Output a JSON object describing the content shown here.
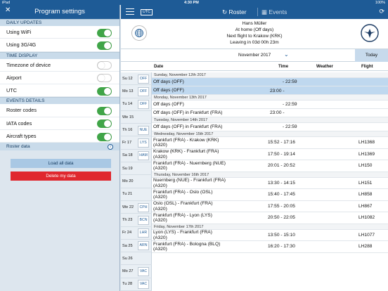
{
  "status": {
    "net": "iPad",
    "time": "4:30 PM",
    "battery": "100%"
  },
  "left": {
    "title": "Program settings",
    "close_icon": "close-icon",
    "sections": [
      {
        "label": "DAILY UPDATES",
        "rows": [
          {
            "label": "Using WiFi",
            "on": true
          },
          {
            "label": "Using 3G/4G",
            "on": true
          }
        ]
      },
      {
        "label": "TIME DISPLAY",
        "rows": [
          {
            "label": "Timezone of device",
            "on": false
          },
          {
            "label": "Airport",
            "on": false
          },
          {
            "label": "UTC",
            "on": true
          }
        ]
      },
      {
        "label": "EVENTS DETAILS",
        "rows": [
          {
            "label": "Roster codes",
            "on": true
          },
          {
            "label": "IATA codes",
            "on": true
          },
          {
            "label": "Aircraft types",
            "on": true
          }
        ]
      }
    ],
    "roster_data_label": "Roster data",
    "load_label": "Load all data",
    "delete_label": "Delete my data"
  },
  "right": {
    "utc_badge": "UTC",
    "tab_roster": "Roster",
    "tab_events": "Events",
    "profile": {
      "name": "Hans Müller",
      "status": "At home (Off days)",
      "next": "Next flight to Krakow (KRK)",
      "leaving": "Leaving in 03d 00h 23m"
    },
    "month": "November 2017",
    "today": "Today",
    "cols": {
      "date": "Date",
      "time": "Time",
      "weather": "Weather",
      "flight": "Flight"
    }
  },
  "colors": {
    "accent": "#1e5b96",
    "toggle_on": "#40a548",
    "delete": "#e0282e"
  },
  "days": [
    {
      "label": "Su  12",
      "code": "OFF"
    },
    {
      "label": "Mo 13",
      "code": "OFF"
    },
    {
      "label": "Tu  14",
      "code": "OFF"
    },
    {
      "label": "We 15",
      "code": ""
    },
    {
      "label": "Th  16",
      "code": "NUE"
    },
    {
      "label": "Fr  17",
      "code": "LYS"
    },
    {
      "label": "Sa  18",
      "code": "HAM"
    },
    {
      "label": "Su  19",
      "code": ""
    },
    {
      "label": "Mo 20",
      "code": ""
    },
    {
      "label": "Tu  21",
      "code": ""
    },
    {
      "label": "We 22",
      "code": "CPH"
    },
    {
      "label": "Th  23",
      "code": "BCN"
    },
    {
      "label": "Fr  24",
      "code": "LHR"
    },
    {
      "label": "Sa  25",
      "code": "ARN"
    },
    {
      "label": "Su  26",
      "code": ""
    },
    {
      "label": "Mo 27",
      "code": "VAC"
    },
    {
      "label": "Tu  28",
      "code": "VAC"
    }
  ],
  "rows": [
    {
      "kind": "sep",
      "text": "Sunday, November 12th 2017"
    },
    {
      "kind": "ev",
      "text": "Off days (OFF)",
      "time": "- 22:59",
      "flight": "",
      "sel": true
    },
    {
      "kind": "ev",
      "text": "Off days (OFF)",
      "time": "23:00 -",
      "flight": "",
      "sel": true
    },
    {
      "kind": "sep",
      "text": "Monday, November 13th 2017"
    },
    {
      "kind": "ev",
      "text": "Off days (OFF)",
      "time": "- 22:59",
      "flight": ""
    },
    {
      "kind": "ev",
      "text": "Off days (OFF) in Frankfurt (FRA)",
      "time": "23:00 -",
      "flight": ""
    },
    {
      "kind": "sep",
      "text": "Tuesday, November 14th 2017"
    },
    {
      "kind": "ev",
      "text": "Off days (OFF) in Frankfurt (FRA)",
      "time": "- 22:59",
      "flight": ""
    },
    {
      "kind": "sep",
      "text": "Wednesday, November 15th 2017"
    },
    {
      "kind": "ev2",
      "text": "Frankfurt (FRA) - Krakow (KRK)",
      "text2": "(A320)",
      "time": "15:52 - 17:16",
      "flight": "LH1368"
    },
    {
      "kind": "ev2",
      "text": "Krakow (KRK) - Frankfurt (FRA)",
      "text2": "(A320)",
      "time": "17:50 - 19:14",
      "flight": "LH1369"
    },
    {
      "kind": "ev2",
      "text": "Frankfurt (FRA) - Nuernberg (NUE)",
      "text2": "(A320)",
      "time": "20:01 - 20:52",
      "flight": "LH150"
    },
    {
      "kind": "sep",
      "text": "Thursday, November 16th 2017"
    },
    {
      "kind": "ev2",
      "text": "Nuernberg (NUE) - Frankfurt (FRA)",
      "text2": "(A320)",
      "time": "13:30 - 14:15",
      "flight": "LH151"
    },
    {
      "kind": "ev2",
      "text": "Frankfurt (FRA) - Oslo (OSL)",
      "text2": "(A320)",
      "time": "15:40 - 17:45",
      "flight": "LH858"
    },
    {
      "kind": "ev2",
      "text": "Oslo (OSL) - Frankfurt (FRA)",
      "text2": "(A320)",
      "time": "17:55 - 20:05",
      "flight": "LH867"
    },
    {
      "kind": "ev2",
      "text": "Frankfurt (FRA) - Lyon (LYS)",
      "text2": "(A320)",
      "time": "20:50 - 22:05",
      "flight": "LH1082"
    },
    {
      "kind": "sep",
      "text": "Friday, November 17th 2017"
    },
    {
      "kind": "ev2",
      "text": "Lyon (LYS) - Frankfurt (FRA)",
      "text2": "(A320)",
      "time": "13:50 - 15:10",
      "flight": "LH1077"
    },
    {
      "kind": "ev2",
      "text": "Frankfurt (FRA) - Bologna (BLQ)",
      "text2": "(A320)",
      "time": "16:20 - 17:30",
      "flight": "LH288"
    }
  ]
}
